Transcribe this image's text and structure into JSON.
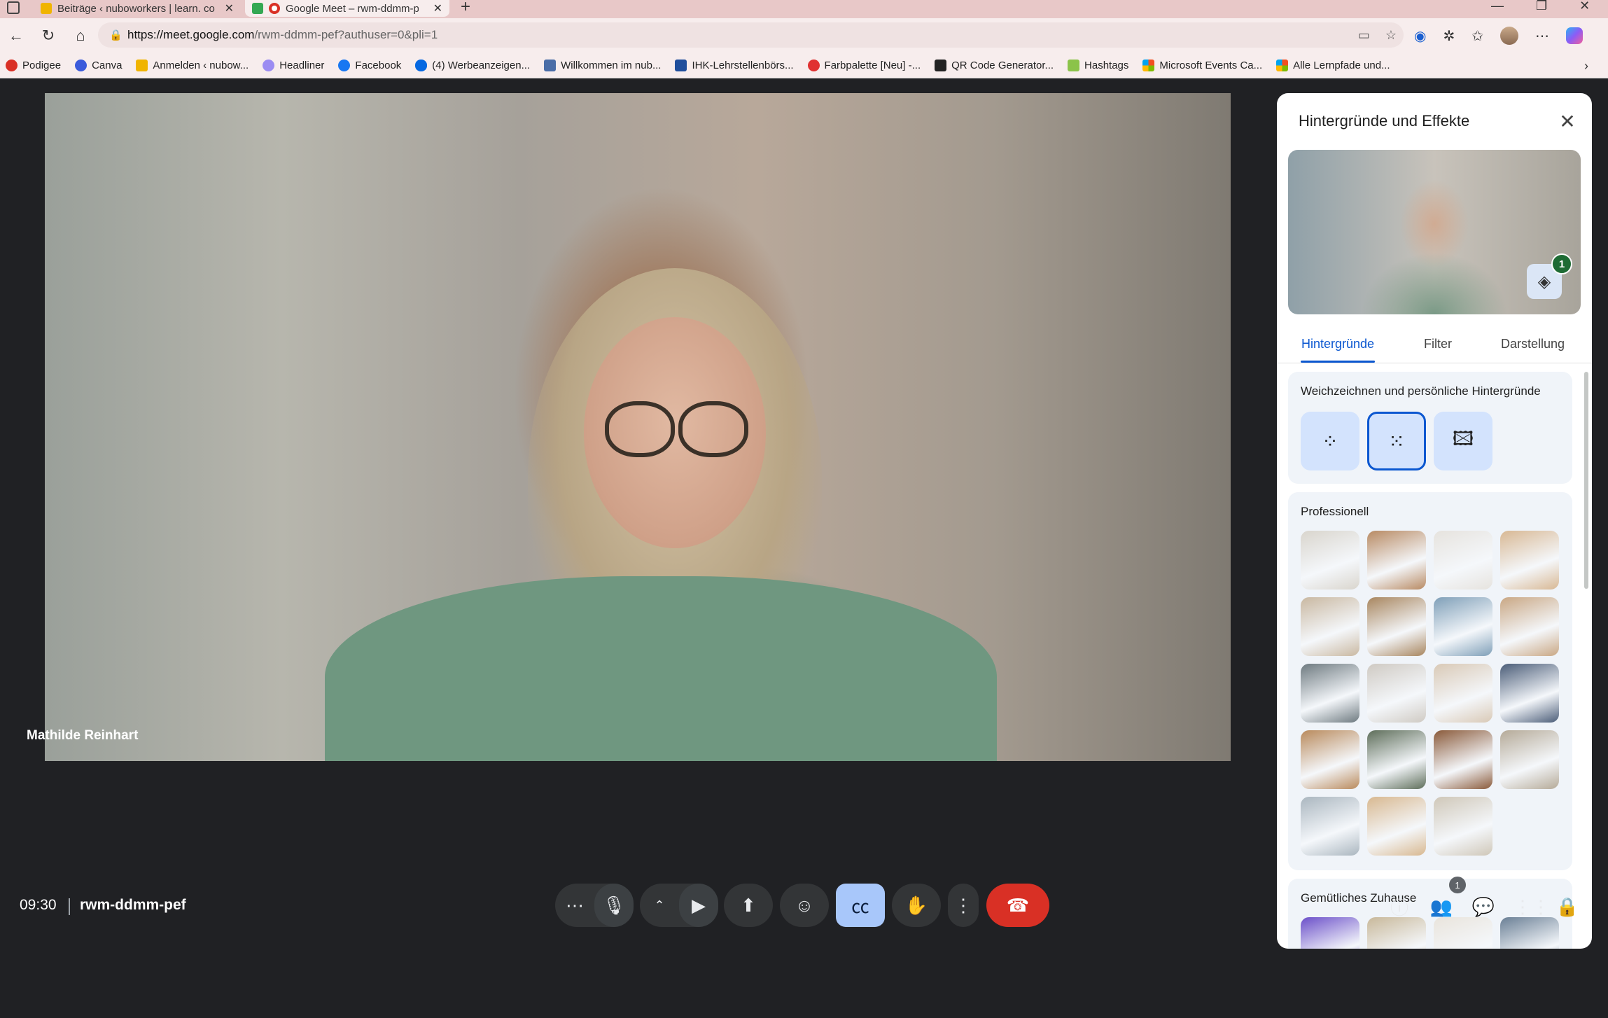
{
  "browser": {
    "tabs": [
      {
        "label": "Beiträge ‹ nuboworkers | learn. co",
        "favicon_color": "#f0b400"
      },
      {
        "label": "Google Meet – rwm-ddmm-p",
        "favicon_color": "#d93025"
      }
    ],
    "url_host": "https://meet.google.com",
    "url_rest": "/rwm-ddmm-pef?authuser=0&pli=1",
    "bookmarks": [
      {
        "label": "Podigee",
        "color": "#d93025"
      },
      {
        "label": "Canva",
        "color": "#3b5bdb"
      },
      {
        "label": "Anmelden ‹ nubow...",
        "color": "#f0b400"
      },
      {
        "label": "Headliner",
        "color": "#9b8cf2"
      },
      {
        "label": "Facebook",
        "color": "#1877f2"
      },
      {
        "label": "(4) Werbeanzeigen...",
        "color": "#0668e1"
      },
      {
        "label": "Willkommen im nub...",
        "color": "#4a6da7"
      },
      {
        "label": "IHK-Lehrstellenbörs...",
        "color": "#1f4e9c"
      },
      {
        "label": "Farbpalette [Neu] -...",
        "color": "#e03131"
      },
      {
        "label": "QR Code Generator...",
        "color": "#222222"
      },
      {
        "label": "Hashtags",
        "color": "#8bc34a"
      },
      {
        "label": "Microsoft Events Ca...",
        "color": "#f25022"
      },
      {
        "label": "Alle Lernpfade und...",
        "color": "#ffb900"
      }
    ]
  },
  "meet": {
    "participant_name": "Mathilde Reinhart",
    "clock": "09:30",
    "meeting_code": "rwm-ddmm-pef",
    "people_count": "1"
  },
  "panel": {
    "title": "Hintergründe und Effekte",
    "effects_badge": "1",
    "tabs": [
      "Hintergründe",
      "Filter",
      "Darstellung"
    ],
    "active_tab": "Hintergründe",
    "section_blur_title": "Weichzeichnen und persönliche Hintergründe",
    "section_professional_title": "Professionell",
    "section_home_title": "Gemütliches Zuhause",
    "professional_thumb_colors": [
      "#d9d5cd",
      "#b88a63",
      "#e6e3de",
      "#d8b894",
      "#c9b8a1",
      "#a8865f",
      "#7f9fb8",
      "#c9a784",
      "#6e7a80",
      "#cfcac3",
      "#d9c9b6",
      "#4b5d78",
      "#b98a5c",
      "#5e6e5a",
      "#8a5a3a",
      "#b5aa98",
      "#aab6bf",
      "#d8b890",
      "#cfc7b8"
    ],
    "home_thumb_colors": [
      "#6b4fc9",
      "#c8b89a",
      "#e9e4dc",
      "#6a7f95"
    ]
  }
}
